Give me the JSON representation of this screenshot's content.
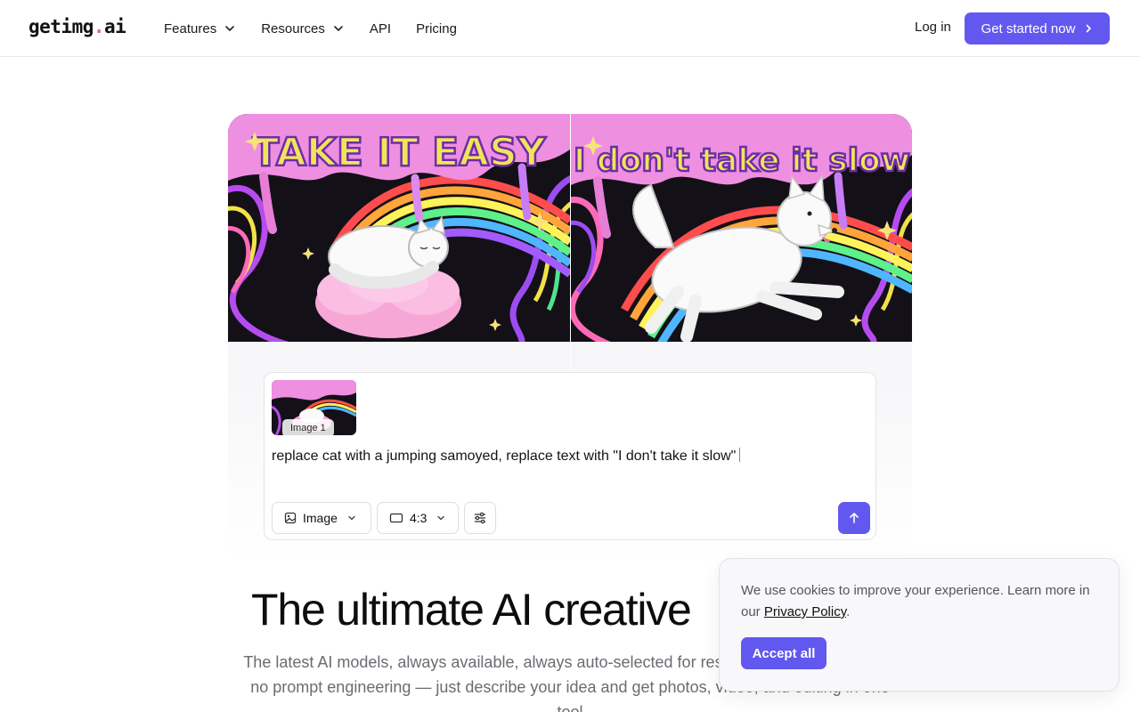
{
  "nav": {
    "logo_main": "getimg",
    "logo_dot": ".",
    "logo_tld": "ai",
    "links": [
      {
        "label": "Features",
        "has_dropdown": true
      },
      {
        "label": "Resources",
        "has_dropdown": true
      },
      {
        "label": "API",
        "has_dropdown": false
      },
      {
        "label": "Pricing",
        "has_dropdown": false
      }
    ],
    "login": "Log in",
    "cta": "Get started now"
  },
  "hero": {
    "left_art_text": "TAKE IT EASY",
    "right_art_text": "I don't take it slow"
  },
  "prompt": {
    "thumb_label": "Image 1",
    "text": "replace cat with a jumping samoyed, replace text with \"I don't take it slow\"",
    "mode": "Image",
    "ratio": "4:3"
  },
  "headline": "The ultimate AI creative",
  "subtext": "The latest AI models, always available, always auto-selected for research, no model picking, no prompt engineering — just describe your idea and get photos, video, and editing in one tool",
  "cookie": {
    "text": "We use cookies to improve your experience. Learn more in our",
    "link": "Privacy Policy",
    "period": ".",
    "accept": "Accept all"
  },
  "colors": {
    "accent": "#6258ef",
    "logo_dot": "#ef5b8a"
  }
}
